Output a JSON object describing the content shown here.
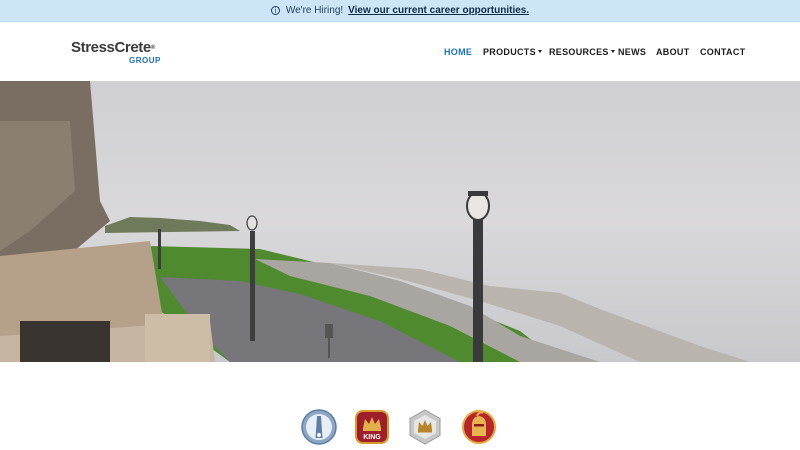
{
  "banner": {
    "icon": "info-circle-icon",
    "lead_text": "We're Hiring!",
    "link_text": "View our current career opportunities.",
    "background": "#cde6f7"
  },
  "logo": {
    "brand_text": "StressCrete",
    "trademark": "®",
    "group_text": "GROUP",
    "brand_color": "#3a3a3a",
    "accent_color": "#1d6fb8"
  },
  "nav": {
    "items": [
      {
        "label": "HOME",
        "active": true,
        "dropdown": false
      },
      {
        "label": "PRODUCTS",
        "active": false,
        "dropdown": true
      },
      {
        "label": "RESOURCES",
        "active": false,
        "dropdown": true
      },
      {
        "label": "NEWS",
        "active": false,
        "dropdown": false
      },
      {
        "label": "ABOUT",
        "active": false,
        "dropdown": false
      },
      {
        "label": "CONTACT",
        "active": false,
        "dropdown": false
      }
    ],
    "active_color": "#1d74b9"
  },
  "brands": [
    {
      "icon": "stresscrete-pole-logo-icon",
      "badge_text": ""
    },
    {
      "icon": "king-crown-logo-icon",
      "badge_text": "KING"
    },
    {
      "icon": "crown-hexagon-logo-icon",
      "badge_text": ""
    },
    {
      "icon": "knight-helmet-logo-icon",
      "badge_text": ""
    }
  ]
}
